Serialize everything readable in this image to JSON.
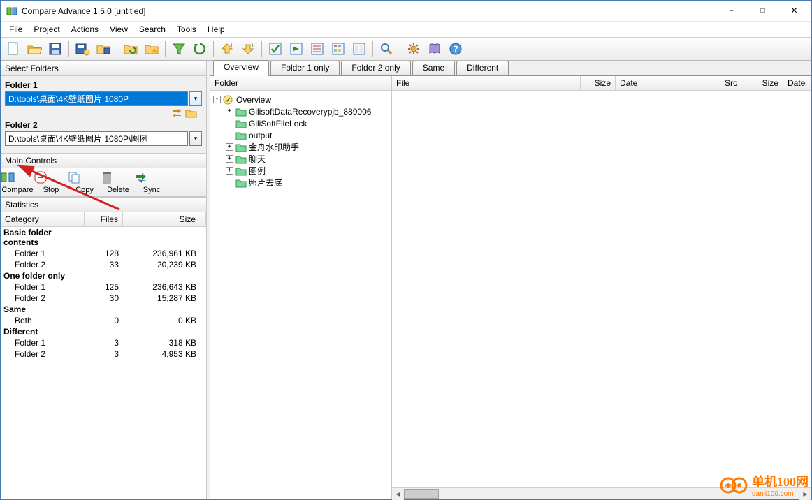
{
  "window": {
    "title": "Compare Advance 1.5.0 [untitled]"
  },
  "menu": {
    "items": [
      "File",
      "Project",
      "Actions",
      "View",
      "Search",
      "Tools",
      "Help"
    ]
  },
  "leftpane": {
    "select_folders_header": "Select Folders",
    "folder1_label": "Folder 1",
    "folder1_value": "D:\\tools\\桌面\\4K壁纸图片 1080P",
    "folder2_label": "Folder 2",
    "folder2_value": "D:\\tools\\桌面\\4K壁纸图片 1080P\\图例",
    "main_controls_header": "Main Controls",
    "controls": [
      "Compare",
      "Stop",
      "Copy",
      "Delete",
      "Sync"
    ],
    "statistics_header": "Statistics",
    "stat_cols": [
      "Category",
      "Files",
      "Size"
    ],
    "stat_groups": [
      {
        "label": "Basic folder contents",
        "rows": [
          {
            "cat": "Folder 1",
            "files": "128",
            "size": "236,961 KB"
          },
          {
            "cat": "Folder 2",
            "files": "33",
            "size": "20,239 KB"
          }
        ]
      },
      {
        "label": "One folder only",
        "rows": [
          {
            "cat": "Folder 1",
            "files": "125",
            "size": "236,643 KB"
          },
          {
            "cat": "Folder 2",
            "files": "30",
            "size": "15,287 KB"
          }
        ]
      },
      {
        "label": "Same",
        "rows": [
          {
            "cat": "Both",
            "files": "0",
            "size": "0 KB"
          }
        ]
      },
      {
        "label": "Different",
        "rows": [
          {
            "cat": "Folder 1",
            "files": "3",
            "size": "318 KB"
          },
          {
            "cat": "Folder 2",
            "files": "3",
            "size": "4,953 KB"
          }
        ]
      }
    ]
  },
  "tabs": [
    "Overview",
    "Folder 1 only",
    "Folder 2 only",
    "Same",
    "Different"
  ],
  "tree": {
    "header": "Folder",
    "root": "Overview",
    "children": [
      {
        "name": "GilisoftDataRecoverypjb_889006",
        "exp": "+",
        "color": "green"
      },
      {
        "name": "GiliSoftFileLock",
        "exp": "",
        "color": "green"
      },
      {
        "name": "output",
        "exp": "",
        "color": "green"
      },
      {
        "name": "金舟水印助手",
        "exp": "+",
        "color": "green"
      },
      {
        "name": "聊天",
        "exp": "+",
        "color": "green"
      },
      {
        "name": "图例",
        "exp": "+",
        "color": "green"
      },
      {
        "name": "照片去底",
        "exp": "",
        "color": "green"
      }
    ]
  },
  "file_cols": [
    "File",
    "Size",
    "Date",
    "Src",
    "Size",
    "Date"
  ],
  "watermark": {
    "t1": "单机100网",
    "t2": "danji100.com"
  }
}
